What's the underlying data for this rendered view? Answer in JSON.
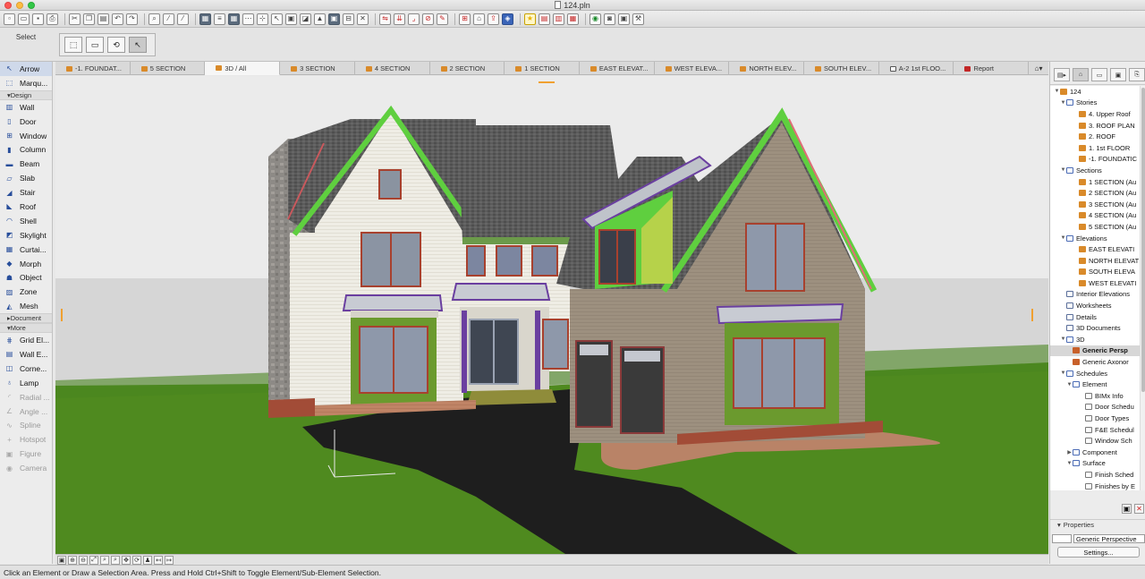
{
  "window": {
    "title": "124.pln"
  },
  "infobox": {
    "select_label": "Select"
  },
  "tabs": [
    {
      "label": "-1. FOUNDAT...",
      "kind": "plan",
      "active": false
    },
    {
      "label": "5 SECTION",
      "kind": "section",
      "active": false
    },
    {
      "label": "3D / All",
      "kind": "3d",
      "active": true
    },
    {
      "label": "3 SECTION",
      "kind": "section",
      "active": false
    },
    {
      "label": "4 SECTION",
      "kind": "section",
      "active": false
    },
    {
      "label": "2 SECTION",
      "kind": "section",
      "active": false
    },
    {
      "label": "1 SECTION",
      "kind": "section",
      "active": false
    },
    {
      "label": "EAST ELEVAT...",
      "kind": "elevation",
      "active": false
    },
    {
      "label": "WEST ELEVA...",
      "kind": "elevation",
      "active": false
    },
    {
      "label": "NORTH ELEV...",
      "kind": "elevation",
      "active": false
    },
    {
      "label": "SOUTH ELEV...",
      "kind": "elevation",
      "active": false
    },
    {
      "label": "A-2 1st FLOO...",
      "kind": "layout",
      "active": false
    },
    {
      "label": "Report",
      "kind": "report",
      "active": false
    }
  ],
  "toolbox": {
    "select_items": [
      {
        "label": "Arrow",
        "icon": "arrow-icon",
        "selected": true
      },
      {
        "label": "Marqu...",
        "icon": "marquee-icon",
        "selected": false
      }
    ],
    "design_header": "Design",
    "design_items": [
      {
        "label": "Wall",
        "icon": "wall-icon",
        "glyph": "▥"
      },
      {
        "label": "Door",
        "icon": "door-icon",
        "glyph": "▯"
      },
      {
        "label": "Window",
        "icon": "window-icon",
        "glyph": "⊞"
      },
      {
        "label": "Column",
        "icon": "column-icon",
        "glyph": "▮"
      },
      {
        "label": "Beam",
        "icon": "beam-icon",
        "glyph": "▬"
      },
      {
        "label": "Slab",
        "icon": "slab-icon",
        "glyph": "▱"
      },
      {
        "label": "Stair",
        "icon": "stair-icon",
        "glyph": "◢"
      },
      {
        "label": "Roof",
        "icon": "roof-icon",
        "glyph": "◣"
      },
      {
        "label": "Shell",
        "icon": "shell-icon",
        "glyph": "◠"
      },
      {
        "label": "Skylight",
        "icon": "skylight-icon",
        "glyph": "◩"
      },
      {
        "label": "Curtai...",
        "icon": "curtain-wall-icon",
        "glyph": "▦"
      },
      {
        "label": "Morph",
        "icon": "morph-icon",
        "glyph": "◆"
      },
      {
        "label": "Object",
        "icon": "object-icon",
        "glyph": "☗"
      },
      {
        "label": "Zone",
        "icon": "zone-icon",
        "glyph": "▨"
      },
      {
        "label": "Mesh",
        "icon": "mesh-icon",
        "glyph": "◭"
      }
    ],
    "document_header": "Document",
    "more_header": "More",
    "more_items": [
      {
        "label": "Grid El...",
        "icon": "grid-element-icon",
        "glyph": "⋕",
        "disabled": false
      },
      {
        "label": "Wall E...",
        "icon": "wall-end-icon",
        "glyph": "▤",
        "disabled": false
      },
      {
        "label": "Corne...",
        "icon": "corner-window-icon",
        "glyph": "◫",
        "disabled": false
      },
      {
        "label": "Lamp",
        "icon": "lamp-icon",
        "glyph": "♁",
        "disabled": false
      },
      {
        "label": "Radial ...",
        "icon": "radial-dimension-icon",
        "glyph": "◜",
        "disabled": true
      },
      {
        "label": "Angle ...",
        "icon": "angle-dimension-icon",
        "glyph": "∠",
        "disabled": true
      },
      {
        "label": "Spline",
        "icon": "spline-icon",
        "glyph": "∿",
        "disabled": true
      },
      {
        "label": "Hotspot",
        "icon": "hotspot-icon",
        "glyph": "+",
        "disabled": true
      },
      {
        "label": "Figure",
        "icon": "figure-icon",
        "glyph": "▣",
        "disabled": true
      },
      {
        "label": "Camera",
        "icon": "camera-icon",
        "glyph": "◉",
        "disabled": true
      }
    ]
  },
  "navigator": {
    "tree": [
      {
        "label": "124",
        "depth": 0,
        "icon": "house",
        "twisty": "▼"
      },
      {
        "label": "Stories",
        "depth": 1,
        "icon": "folder",
        "twisty": "▼"
      },
      {
        "label": "4. Upper Roof",
        "depth": 3,
        "icon": "house",
        "twisty": ""
      },
      {
        "label": "3. ROOF PLAN",
        "depth": 3,
        "icon": "house",
        "twisty": ""
      },
      {
        "label": "2. ROOF",
        "depth": 3,
        "icon": "house",
        "twisty": ""
      },
      {
        "label": "1. 1st FLOOR",
        "depth": 3,
        "icon": "house",
        "twisty": ""
      },
      {
        "label": "-1. FOUNDATIC",
        "depth": 3,
        "icon": "house",
        "twisty": ""
      },
      {
        "label": "Sections",
        "depth": 1,
        "icon": "folder",
        "twisty": "▼"
      },
      {
        "label": "1 SECTION (Au",
        "depth": 3,
        "icon": "house",
        "twisty": ""
      },
      {
        "label": "2 SECTION (Au",
        "depth": 3,
        "icon": "house",
        "twisty": ""
      },
      {
        "label": "3 SECTION (Au",
        "depth": 3,
        "icon": "house",
        "twisty": ""
      },
      {
        "label": "4 SECTION (Au",
        "depth": 3,
        "icon": "house",
        "twisty": ""
      },
      {
        "label": "5 SECTION (Au",
        "depth": 3,
        "icon": "house",
        "twisty": ""
      },
      {
        "label": "Elevations",
        "depth": 1,
        "icon": "folder",
        "twisty": "▼"
      },
      {
        "label": "EAST ELEVATI",
        "depth": 3,
        "icon": "house",
        "twisty": ""
      },
      {
        "label": "NORTH ELEVAT",
        "depth": 3,
        "icon": "house",
        "twisty": ""
      },
      {
        "label": "SOUTH ELEVA",
        "depth": 3,
        "icon": "house",
        "twisty": ""
      },
      {
        "label": "WEST ELEVATI",
        "depth": 3,
        "icon": "house",
        "twisty": ""
      },
      {
        "label": "Interior Elevations",
        "depth": 1,
        "icon": "doc",
        "twisty": ""
      },
      {
        "label": "Worksheets",
        "depth": 1,
        "icon": "doc",
        "twisty": ""
      },
      {
        "label": "Details",
        "depth": 1,
        "icon": "doc",
        "twisty": ""
      },
      {
        "label": "3D Documents",
        "depth": 1,
        "icon": "doc",
        "twisty": ""
      },
      {
        "label": "3D",
        "depth": 1,
        "icon": "folder",
        "twisty": "▼"
      },
      {
        "label": "Generic Persp",
        "depth": 2,
        "icon": "persp",
        "twisty": "",
        "selected": true
      },
      {
        "label": "Generic Axonor",
        "depth": 2,
        "icon": "persp",
        "twisty": ""
      },
      {
        "label": "Schedules",
        "depth": 1,
        "icon": "folder",
        "twisty": "▼"
      },
      {
        "label": "Element",
        "depth": 2,
        "icon": "folder",
        "twisty": "▼"
      },
      {
        "label": "BIMx Info",
        "depth": 4,
        "icon": "sched",
        "twisty": ""
      },
      {
        "label": "Door Schedu",
        "depth": 4,
        "icon": "sched",
        "twisty": ""
      },
      {
        "label": "Door Types",
        "depth": 4,
        "icon": "sched",
        "twisty": ""
      },
      {
        "label": "F&E Schedul",
        "depth": 4,
        "icon": "sched",
        "twisty": ""
      },
      {
        "label": "Window Sch",
        "depth": 4,
        "icon": "sched",
        "twisty": ""
      },
      {
        "label": "Component",
        "depth": 2,
        "icon": "folder",
        "twisty": "▶"
      },
      {
        "label": "Surface",
        "depth": 2,
        "icon": "folder",
        "twisty": "▼"
      },
      {
        "label": "Finish Sched",
        "depth": 4,
        "icon": "sched",
        "twisty": ""
      },
      {
        "label": "Finishes by E",
        "depth": 4,
        "icon": "sched",
        "twisty": ""
      }
    ],
    "properties_header": "Properties",
    "properties_value": "Generic Perspective",
    "settings_label": "Settings..."
  },
  "status": {
    "text": "Click an Element or Draw a Selection Area. Press and Hold Ctrl+Shift to Toggle Element/Sub-Element Selection."
  },
  "colors": {
    "grass": "#4f8a1f",
    "roof": "#5a5a5a",
    "trim_green": "#5fcf3f",
    "siding_cream": "#ece9df",
    "siding_taupe": "#9c8f7e",
    "driveway": "#1e1e1e",
    "window_frame": "#a8412e"
  }
}
